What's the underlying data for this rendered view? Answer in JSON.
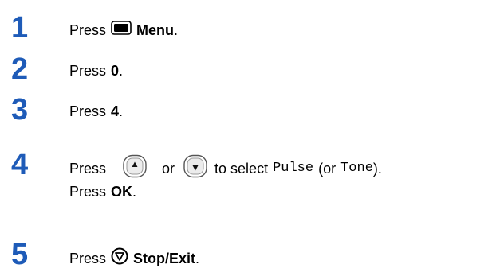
{
  "accent_color": "#1e5bb8",
  "steps": [
    {
      "number": "1",
      "press": "Press",
      "button_label": "Menu",
      "icon": "menu-key-icon",
      "suffix": "."
    },
    {
      "number": "2",
      "press": "Press",
      "key": "0",
      "suffix": "."
    },
    {
      "number": "3",
      "press": "Press",
      "key": "4",
      "suffix": "."
    },
    {
      "number": "4",
      "press": "Press",
      "up_icon": "up-arrow-key-icon",
      "or_text": "or",
      "down_icon": "down-arrow-key-icon",
      "select_text": "to select",
      "option_pulse": "Pulse",
      "open_paren": "(or",
      "option_tone": "Tone",
      "close_paren": ").",
      "press2": "Press",
      "key2": "OK",
      "suffix2": "."
    },
    {
      "number": "5",
      "press": "Press",
      "button_label": "Stop/Exit",
      "icon": "stop-exit-key-icon",
      "suffix": "."
    }
  ]
}
